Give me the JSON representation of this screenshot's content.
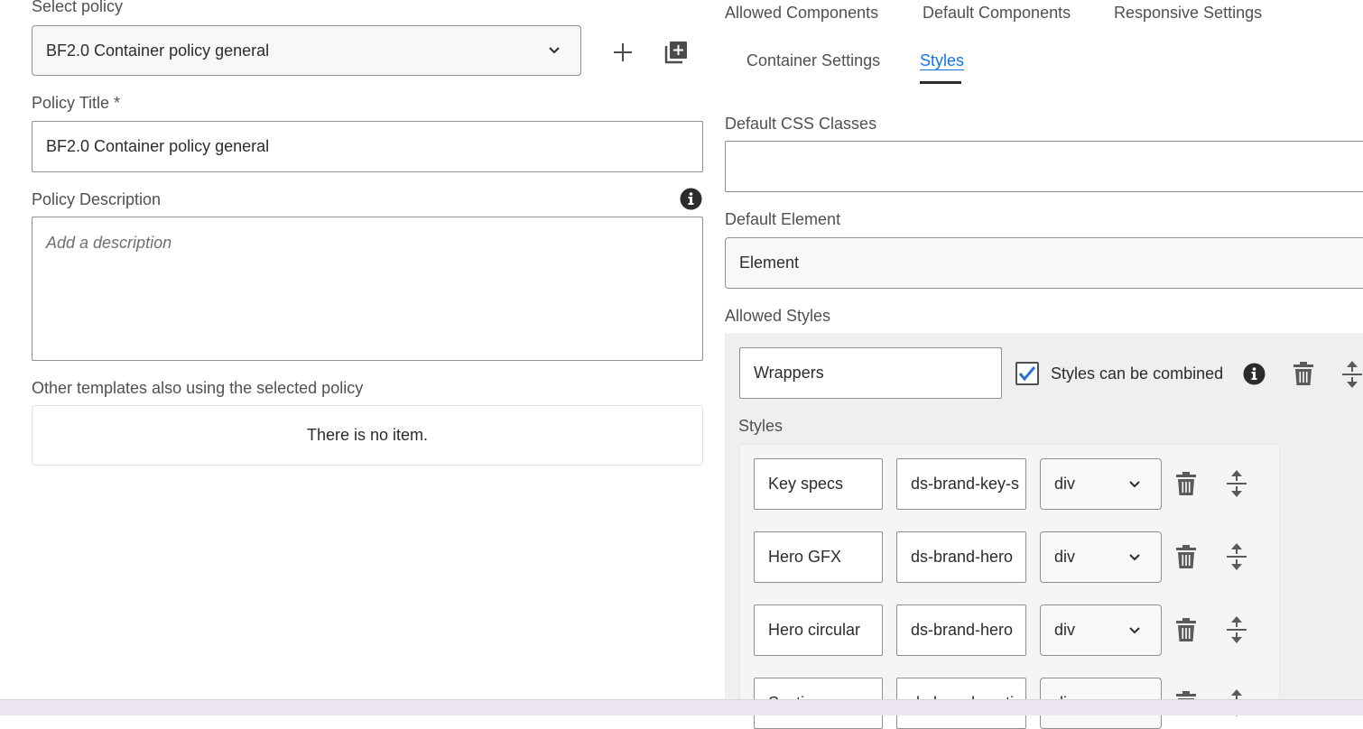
{
  "left": {
    "select_policy_label": "Select policy",
    "selected_policy": "BF2.0 Container policy general",
    "policy_title_label": "Policy Title *",
    "policy_title_value": "BF2.0 Container policy general",
    "policy_description_label": "Policy Description",
    "policy_description_placeholder": "Add a description",
    "other_templates_label": "Other templates also using the selected policy",
    "empty_message": "There is no item."
  },
  "tabs": [
    {
      "label": "Allowed Components"
    },
    {
      "label": "Default Components"
    },
    {
      "label": "Responsive Settings"
    },
    {
      "label": "Container Settings"
    },
    {
      "label": "Styles"
    }
  ],
  "right": {
    "default_css_label": "Default CSS Classes",
    "default_css_value": "",
    "default_element_label": "Default Element",
    "default_element_value": "Element",
    "allowed_styles_label": "Allowed Styles",
    "group_name": "Wrappers",
    "combine_label": "Styles can be combined",
    "combine_checked": true,
    "styles_label": "Styles",
    "styles": [
      {
        "name": "Key specs",
        "css": "ds-brand-key-s",
        "element": "div"
      },
      {
        "name": "Hero GFX",
        "css": "ds-brand-hero",
        "element": "div"
      },
      {
        "name": "Hero circular",
        "css": "ds-brand-hero",
        "element": "div"
      },
      {
        "name": "Section",
        "css": "ds-brand-section",
        "element": "div"
      }
    ]
  },
  "colors": {
    "accent": "#1473e6",
    "checkbox": "#2b6fd6"
  }
}
